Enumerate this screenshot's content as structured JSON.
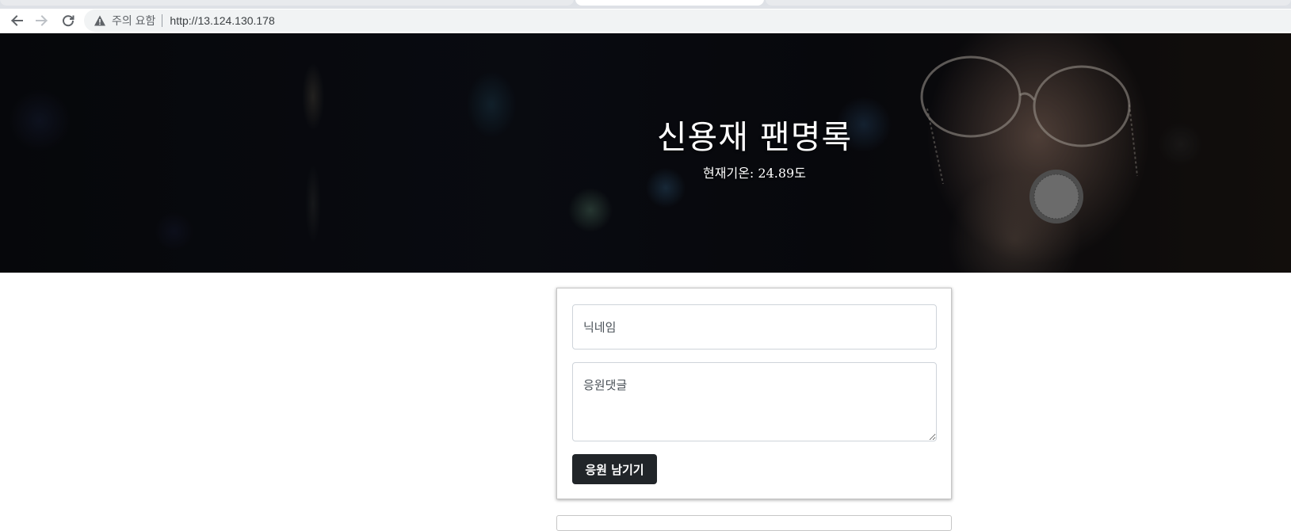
{
  "browser": {
    "security_label": "주의 요함",
    "url": "http://13.124.130.178",
    "icons": {
      "back": "arrow-left-icon",
      "forward": "arrow-right-icon",
      "reload": "reload-icon",
      "security": "warning-triangle-icon"
    }
  },
  "header": {
    "title": "신용재 팬명록",
    "weather": "현재기온: 24.89도"
  },
  "form": {
    "nickname_placeholder": "닉네임",
    "comment_placeholder": "응원댓글",
    "submit_label": "응원 남기기"
  },
  "colors": {
    "button": "#212529",
    "omnibox": "#f1f3f4",
    "hero_text": "#ffffff"
  }
}
